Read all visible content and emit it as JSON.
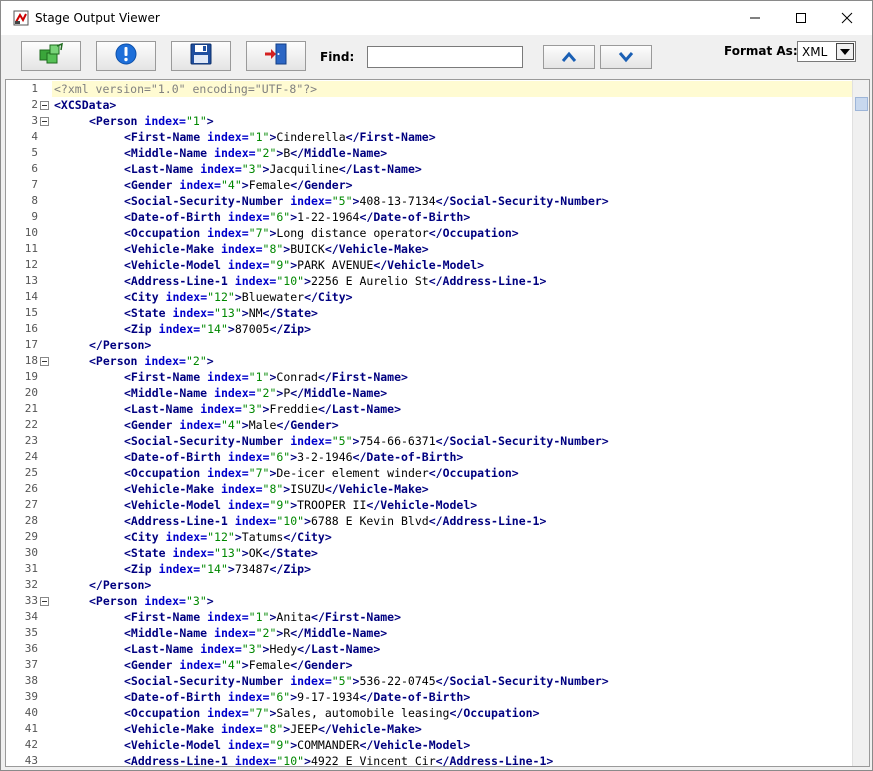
{
  "window": {
    "title": "Stage Output Viewer"
  },
  "toolbar": {
    "find_label": "Find:",
    "find_value": "",
    "format_label": "Format As:",
    "format_value": "XML",
    "format_options_visible": [
      "XML"
    ]
  },
  "icons": {
    "app": "stage-viewer-icon",
    "refresh": "refresh-cubes-icon",
    "info": "info-icon",
    "save": "save-disk-icon",
    "exit": "exit-door-icon",
    "up": "chevron-up-icon",
    "down": "chevron-down-icon"
  },
  "colors": {
    "tag": "#000080",
    "attribute": "#0000cc",
    "value": "#008800",
    "declaration": "#808080",
    "current_line": "#fffbd2",
    "button_arrow": "#1a5fb4"
  },
  "editor": {
    "current_line": 1,
    "folded_lines": [
      2,
      3,
      18,
      33
    ],
    "lines": [
      {
        "n": "1",
        "indent": 0,
        "decl": "<?xml version=\"1.0\" encoding=\"UTF-8\"?>"
      },
      {
        "n": "2",
        "indent": 0,
        "open": "XCSData"
      },
      {
        "n": "3",
        "indent": 1,
        "open": "Person",
        "attr": "index",
        "val": "\"1\""
      },
      {
        "n": "4",
        "indent": 2,
        "open": "First-Name",
        "attr": "index",
        "val": "\"1\"",
        "text": "Cinderella",
        "close": "First-Name"
      },
      {
        "n": "5",
        "indent": 2,
        "open": "Middle-Name",
        "attr": "index",
        "val": "\"2\"",
        "text": "B",
        "close": "Middle-Name"
      },
      {
        "n": "6",
        "indent": 2,
        "open": "Last-Name",
        "attr": "index",
        "val": "\"3\"",
        "text": "Jacquiline",
        "close": "Last-Name"
      },
      {
        "n": "7",
        "indent": 2,
        "open": "Gender",
        "attr": "index",
        "val": "\"4\"",
        "text": "Female",
        "close": "Gender"
      },
      {
        "n": "8",
        "indent": 2,
        "open": "Social-Security-Number",
        "attr": "index",
        "val": "\"5\"",
        "text": "408-13-7134",
        "close": "Social-Security-Number"
      },
      {
        "n": "9",
        "indent": 2,
        "open": "Date-of-Birth",
        "attr": "index",
        "val": "\"6\"",
        "text": "1-22-1964",
        "close": "Date-of-Birth"
      },
      {
        "n": "10",
        "indent": 2,
        "open": "Occupation",
        "attr": "index",
        "val": "\"7\"",
        "text": "Long distance operator",
        "close": "Occupation"
      },
      {
        "n": "11",
        "indent": 2,
        "open": "Vehicle-Make",
        "attr": "index",
        "val": "\"8\"",
        "text": "BUICK",
        "close": "Vehicle-Make"
      },
      {
        "n": "12",
        "indent": 2,
        "open": "Vehicle-Model",
        "attr": "index",
        "val": "\"9\"",
        "text": "PARK AVENUE",
        "close": "Vehicle-Model"
      },
      {
        "n": "13",
        "indent": 2,
        "open": "Address-Line-1",
        "attr": "index",
        "val": "\"10\"",
        "text": "2256 E Aurelio St",
        "close": "Address-Line-1"
      },
      {
        "n": "14",
        "indent": 2,
        "open": "City",
        "attr": "index",
        "val": "\"12\"",
        "text": "Bluewater",
        "close": "City"
      },
      {
        "n": "15",
        "indent": 2,
        "open": "State",
        "attr": "index",
        "val": "\"13\"",
        "text": "NM",
        "close": "State"
      },
      {
        "n": "16",
        "indent": 2,
        "open": "Zip",
        "attr": "index",
        "val": "\"14\"",
        "text": "87005",
        "close": "Zip"
      },
      {
        "n": "17",
        "indent": 1,
        "close": "Person"
      },
      {
        "n": "18",
        "indent": 1,
        "open": "Person",
        "attr": "index",
        "val": "\"2\""
      },
      {
        "n": "19",
        "indent": 2,
        "open": "First-Name",
        "attr": "index",
        "val": "\"1\"",
        "text": "Conrad",
        "close": "First-Name"
      },
      {
        "n": "20",
        "indent": 2,
        "open": "Middle-Name",
        "attr": "index",
        "val": "\"2\"",
        "text": "P",
        "close": "Middle-Name"
      },
      {
        "n": "21",
        "indent": 2,
        "open": "Last-Name",
        "attr": "index",
        "val": "\"3\"",
        "text": "Freddie",
        "close": "Last-Name"
      },
      {
        "n": "22",
        "indent": 2,
        "open": "Gender",
        "attr": "index",
        "val": "\"4\"",
        "text": "Male",
        "close": "Gender"
      },
      {
        "n": "23",
        "indent": 2,
        "open": "Social-Security-Number",
        "attr": "index",
        "val": "\"5\"",
        "text": "754-66-6371",
        "close": "Social-Security-Number"
      },
      {
        "n": "24",
        "indent": 2,
        "open": "Date-of-Birth",
        "attr": "index",
        "val": "\"6\"",
        "text": "3-2-1946",
        "close": "Date-of-Birth"
      },
      {
        "n": "25",
        "indent": 2,
        "open": "Occupation",
        "attr": "index",
        "val": "\"7\"",
        "text": "De-icer element winder",
        "close": "Occupation"
      },
      {
        "n": "26",
        "indent": 2,
        "open": "Vehicle-Make",
        "attr": "index",
        "val": "\"8\"",
        "text": "ISUZU",
        "close": "Vehicle-Make"
      },
      {
        "n": "27",
        "indent": 2,
        "open": "Vehicle-Model",
        "attr": "index",
        "val": "\"9\"",
        "text": "TROOPER II",
        "close": "Vehicle-Model"
      },
      {
        "n": "28",
        "indent": 2,
        "open": "Address-Line-1",
        "attr": "index",
        "val": "\"10\"",
        "text": "6788 E Kevin Blvd",
        "close": "Address-Line-1"
      },
      {
        "n": "29",
        "indent": 2,
        "open": "City",
        "attr": "index",
        "val": "\"12\"",
        "text": "Tatums",
        "close": "City"
      },
      {
        "n": "30",
        "indent": 2,
        "open": "State",
        "attr": "index",
        "val": "\"13\"",
        "text": "OK",
        "close": "State"
      },
      {
        "n": "31",
        "indent": 2,
        "open": "Zip",
        "attr": "index",
        "val": "\"14\"",
        "text": "73487",
        "close": "Zip"
      },
      {
        "n": "32",
        "indent": 1,
        "close": "Person"
      },
      {
        "n": "33",
        "indent": 1,
        "open": "Person",
        "attr": "index",
        "val": "\"3\""
      },
      {
        "n": "34",
        "indent": 2,
        "open": "First-Name",
        "attr": "index",
        "val": "\"1\"",
        "text": "Anita",
        "close": "First-Name"
      },
      {
        "n": "35",
        "indent": 2,
        "open": "Middle-Name",
        "attr": "index",
        "val": "\"2\"",
        "text": "R",
        "close": "Middle-Name"
      },
      {
        "n": "36",
        "indent": 2,
        "open": "Last-Name",
        "attr": "index",
        "val": "\"3\"",
        "text": "Hedy",
        "close": "Last-Name"
      },
      {
        "n": "37",
        "indent": 2,
        "open": "Gender",
        "attr": "index",
        "val": "\"4\"",
        "text": "Female",
        "close": "Gender"
      },
      {
        "n": "38",
        "indent": 2,
        "open": "Social-Security-Number",
        "attr": "index",
        "val": "\"5\"",
        "text": "536-22-0745",
        "close": "Social-Security-Number"
      },
      {
        "n": "39",
        "indent": 2,
        "open": "Date-of-Birth",
        "attr": "index",
        "val": "\"6\"",
        "text": "9-17-1934",
        "close": "Date-of-Birth"
      },
      {
        "n": "40",
        "indent": 2,
        "open": "Occupation",
        "attr": "index",
        "val": "\"7\"",
        "text": "Sales, automobile leasing",
        "close": "Occupation"
      },
      {
        "n": "41",
        "indent": 2,
        "open": "Vehicle-Make",
        "attr": "index",
        "val": "\"8\"",
        "text": "JEEP",
        "close": "Vehicle-Make"
      },
      {
        "n": "42",
        "indent": 2,
        "open": "Vehicle-Model",
        "attr": "index",
        "val": "\"9\"",
        "text": "COMMANDER",
        "close": "Vehicle-Model"
      },
      {
        "n": "43",
        "indent": 2,
        "open": "Address-Line-1",
        "attr": "index",
        "val": "\"10\"",
        "text": "4922 E Vincent Cir",
        "close": "Address-Line-1"
      }
    ]
  }
}
